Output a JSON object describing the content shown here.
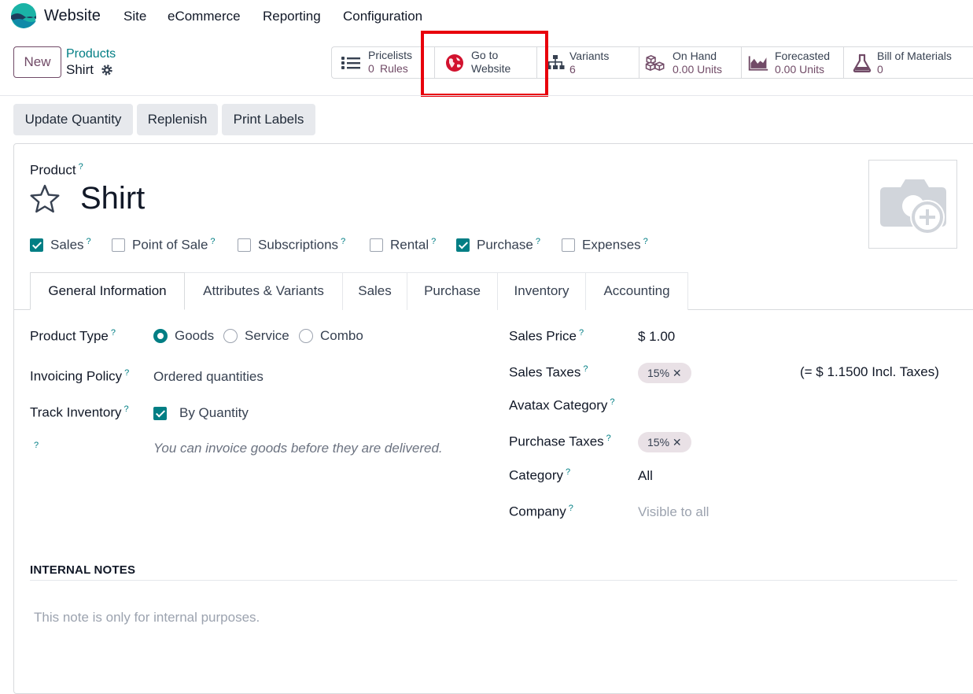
{
  "app": {
    "name": "Website"
  },
  "nav": [
    "Site",
    "eCommerce",
    "Reporting",
    "Configuration"
  ],
  "control": {
    "new_label": "New",
    "breadcrumb_parent": "Products",
    "breadcrumb_current": "Shirt"
  },
  "stats": [
    {
      "label": "Pricelists",
      "value": "0",
      "value2": "Rules",
      "icon": "list-icon"
    },
    {
      "label": "Go to",
      "value": "Website",
      "icon": "globe-icon"
    },
    {
      "label": "Variants",
      "value": "6",
      "icon": "sitemap-icon"
    },
    {
      "label": "On Hand",
      "value": "0.00 Units",
      "icon": "cubes-icon"
    },
    {
      "label": "Forecasted",
      "value": "0.00 Units",
      "icon": "area-chart-icon"
    },
    {
      "label": "Bill of Materials",
      "value": "0",
      "icon": "flask-icon"
    }
  ],
  "actions": [
    "Update Quantity",
    "Replenish",
    "Print Labels"
  ],
  "form": {
    "product_label": "Product",
    "product_name": "Shirt",
    "help": "?",
    "checkboxes": [
      {
        "label": "Sales",
        "checked": true
      },
      {
        "label": "Point of Sale",
        "checked": false
      },
      {
        "label": "Subscriptions",
        "checked": false
      },
      {
        "label": "Rental",
        "checked": false
      },
      {
        "label": "Purchase",
        "checked": true
      },
      {
        "label": "Expenses",
        "checked": false
      }
    ],
    "tabs": [
      "General Information",
      "Attributes & Variants",
      "Sales",
      "Purchase",
      "Inventory",
      "Accounting"
    ],
    "active_tab": "General Information",
    "left": {
      "product_type_label": "Product Type",
      "product_type_options": [
        "Goods",
        "Service",
        "Combo"
      ],
      "product_type_selected": "Goods",
      "invoicing_label": "Invoicing Policy",
      "invoicing_value": "Ordered quantities",
      "track_label": "Track Inventory",
      "track_value": "By Quantity",
      "hint": "You can invoice goods before they are delivered."
    },
    "right": {
      "sales_price_label": "Sales Price",
      "sales_price_value": "$ 1.00",
      "sales_taxes_label": "Sales Taxes",
      "sales_taxes_tag": "15%",
      "sales_taxes_incl": "(= $ 1.1500 Incl. Taxes)",
      "avatax_label": "Avatax Category",
      "purchase_taxes_label": "Purchase Taxes",
      "purchase_taxes_tag": "15%",
      "category_label": "Category",
      "category_value": "All",
      "company_label": "Company",
      "company_value": "Visible to all"
    },
    "notes_title": "INTERNAL NOTES",
    "notes_placeholder": "This note is only for internal purposes."
  },
  "colors": {
    "brand": "#714b67",
    "accent": "#017e84",
    "highlight": "#e8000c"
  }
}
